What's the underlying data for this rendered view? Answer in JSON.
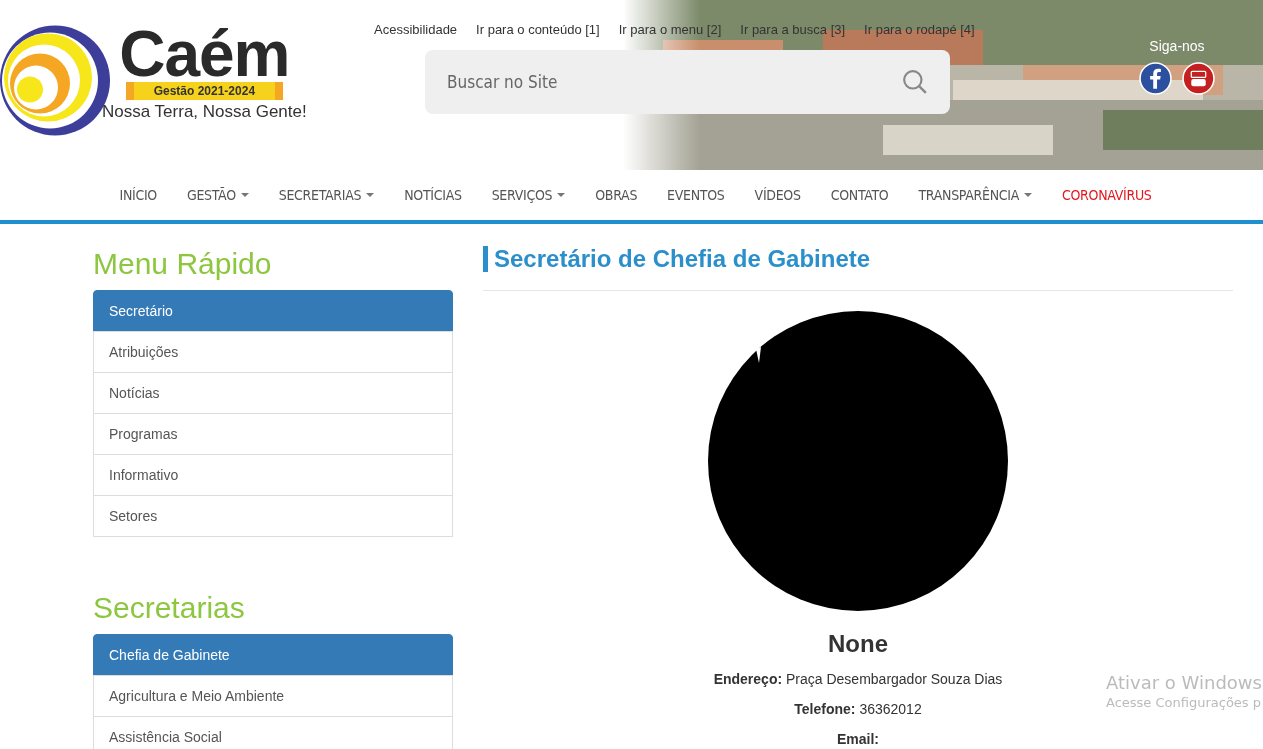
{
  "header": {
    "logo": {
      "name": "Caém",
      "term": "Gestão 2021-2024",
      "slogan": "Nossa Terra, Nossa Gente!"
    },
    "access_links": [
      "Acessibilidade",
      "Ir para o conteúdo [1]",
      "Ir para o menu [2]",
      "Ir para a busca [3]",
      "Ir para o rodapé [4]"
    ],
    "search": {
      "placeholder": "Buscar no Site"
    },
    "social": {
      "label": "Siga-nos"
    }
  },
  "nav": [
    {
      "label": "INÍCIO",
      "dropdown": false,
      "highlight": false
    },
    {
      "label": "GESTÃO",
      "dropdown": true,
      "highlight": false
    },
    {
      "label": "SECRETARIAS",
      "dropdown": true,
      "highlight": false
    },
    {
      "label": "NOTÍCIAS",
      "dropdown": false,
      "highlight": false
    },
    {
      "label": "SERVIÇOS",
      "dropdown": true,
      "highlight": false
    },
    {
      "label": "OBRAS",
      "dropdown": false,
      "highlight": false
    },
    {
      "label": "EVENTOS",
      "dropdown": false,
      "highlight": false
    },
    {
      "label": "VÍDEOS",
      "dropdown": false,
      "highlight": false
    },
    {
      "label": "CONTATO",
      "dropdown": false,
      "highlight": false
    },
    {
      "label": "TRANSPARÊNCIA",
      "dropdown": true,
      "highlight": false
    },
    {
      "label": "CORONAVÍRUS",
      "dropdown": false,
      "highlight": true
    }
  ],
  "sidebar": [
    {
      "title": "Menu Rápido",
      "items": [
        {
          "label": "Secretário",
          "selected": true
        },
        {
          "label": "Atribuições",
          "selected": false
        },
        {
          "label": "Notícias",
          "selected": false
        },
        {
          "label": "Programas",
          "selected": false
        },
        {
          "label": "Informativo",
          "selected": false
        },
        {
          "label": "Setores",
          "selected": false
        }
      ]
    },
    {
      "title": "Secretarias",
      "items": [
        {
          "label": "Chefia de Gabinete",
          "selected": true
        },
        {
          "label": "Agricultura e Meio Ambiente",
          "selected": false
        },
        {
          "label": "Assistência Social",
          "selected": false
        }
      ]
    }
  ],
  "content": {
    "title": "Secretário de Chefia de Gabinete",
    "name": "None",
    "details": [
      {
        "label": "Endereço:",
        "value": "Praça Desembargador Souza Dias"
      },
      {
        "label": "Telefone:",
        "value": "36362012"
      },
      {
        "label": "Email:"
      }
    ]
  },
  "os_overlay": {
    "title": "Ativar o Windows",
    "text": "Acesse Configurações p"
  }
}
